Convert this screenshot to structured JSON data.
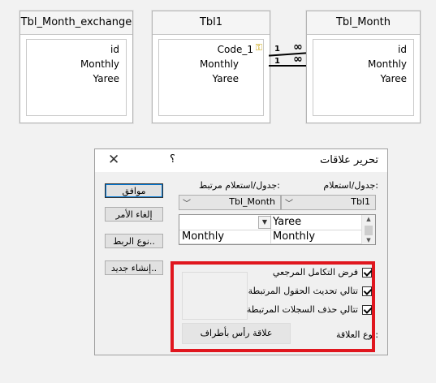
{
  "tables": [
    {
      "title": "Tbl_Month_exchange",
      "fields": [
        "id",
        "Monthly",
        "Yaree"
      ]
    },
    {
      "title": "Tbl1",
      "fields": [
        "Code_1",
        "Monthly",
        "Yaree"
      ],
      "key_icon": "key-icon"
    },
    {
      "title": "Tbl_Month",
      "fields": [
        "id",
        "Monthly",
        "Yaree"
      ]
    }
  ],
  "relationships": [
    {
      "one": "1",
      "many": "∞"
    },
    {
      "one": "1",
      "many": "∞"
    }
  ],
  "dialog": {
    "title": "تحرير علاقات",
    "help": "؟",
    "close": "✕",
    "buttons": {
      "ok": "موافق",
      "cancel": "إلغاء الأمر",
      "join_type": "نوع الربط..",
      "create_new": "إنشاء جديد.."
    },
    "table_label": "جدول/استعلام:",
    "related_label": "جدول/استعلام مرتبط:",
    "table_value": "Tbl1",
    "related_value": "Tbl_Month",
    "grid_rows": [
      [
        "Yaree",
        ""
      ],
      [
        "Monthly",
        "Monthly"
      ]
    ],
    "options": {
      "enforce": "فرض التكامل المرجعي",
      "cascade_update": "تتالي تحديث الحقول المرتبطة",
      "cascade_delete": "تتالي حذف السجلات المرتبطة"
    },
    "relationship_type_label": "نوع العلاقة:",
    "relationship_type_value": "علاقة رأس بأطراف"
  },
  "colors": {
    "highlight_frame": "#e0161e"
  }
}
